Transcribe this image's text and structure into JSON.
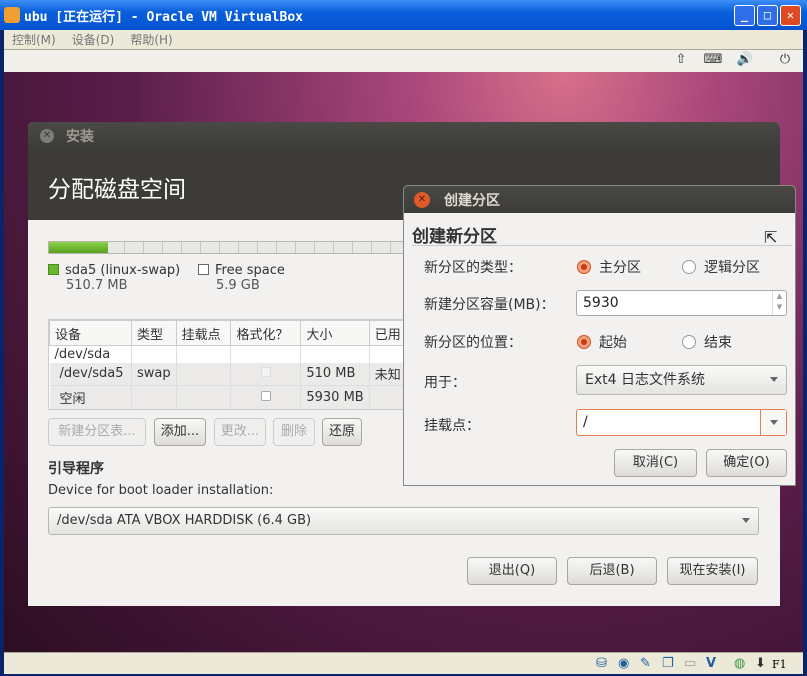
{
  "window": {
    "title": "ubu [正在运行] - Oracle VM VirtualBox",
    "minimize": "_",
    "maximize": "□",
    "close": "✕"
  },
  "menu": [
    "控制(M)",
    "设备(D)",
    "帮助(H)"
  ],
  "toolbar": {
    "icons": [
      "network-icon",
      "keyboard-icon",
      "volume-icon",
      "power-icon"
    ],
    "glyphs": [
      "⇧",
      "⌨",
      "🔊",
      "⏻"
    ]
  },
  "statusbar": {
    "icons": [
      "harddisk-icon",
      "cdrom-icon",
      "usb-icon",
      "network-icon",
      "shared-folder-icon",
      "vrde-icon",
      "mouse-integration-icon",
      "keyboard-capture-icon"
    ],
    "glyphs": [
      "⛁",
      "◉",
      "✎",
      "❐",
      "▭",
      "V",
      "◍",
      "⬇"
    ],
    "host_key": "F1"
  },
  "installer": {
    "title": "安装",
    "heading": "分配磁盘空间",
    "usage": {
      "used_fraction": 0.08,
      "color": "#6ab82c"
    },
    "legend": [
      {
        "name": "sda5 (linux-swap)",
        "size": "510.7 MB",
        "color": "#6ab82c"
      },
      {
        "name": "Free space",
        "size": "5.9 GB",
        "color": "#ffffff"
      }
    ],
    "table": {
      "headers": [
        "设备",
        "类型",
        "挂载点",
        "格式化？",
        "大小",
        "已用"
      ],
      "rows": [
        {
          "device": "/dev/sda",
          "type": "",
          "mount": "",
          "format": null,
          "size": "",
          "used": ""
        },
        {
          "device": "/dev/sda5",
          "type": "swap",
          "mount": "",
          "format": false,
          "size": "510 MB",
          "used": "未知"
        },
        {
          "device": "空闲",
          "type": "",
          "mount": "",
          "format": false,
          "size": "5930 MB",
          "used": ""
        }
      ]
    },
    "buttons": {
      "new_table": "新建分区表...",
      "add": "添加...",
      "change": "更改...",
      "delete": "删除",
      "revert": "还原"
    },
    "bootloader": {
      "heading": "引导程序",
      "label": "Device for boot loader installation:",
      "device": "/dev/sda ATA VBOX HARDDISK (6.4 GB)"
    },
    "nav": {
      "quit": "退出(Q)",
      "back": "后退(B)",
      "install": "现在安装(I)"
    }
  },
  "dialog": {
    "title": "创建分区",
    "heading": "创建新分区",
    "type_label": "新分区的类型：",
    "type_options": [
      "主分区",
      "逻辑分区"
    ],
    "type_selected": "主分区",
    "size_label": "新建分区容量(MB)：",
    "size_value": "5930",
    "location_label": "新分区的位置：",
    "location_options": [
      "起始",
      "结束"
    ],
    "location_selected": "起始",
    "use_label": "用于：",
    "use_value": "Ext4 日志文件系统",
    "mount_label": "挂载点：",
    "mount_value": "/",
    "cancel": "取消(C)",
    "ok": "确定(O)"
  }
}
